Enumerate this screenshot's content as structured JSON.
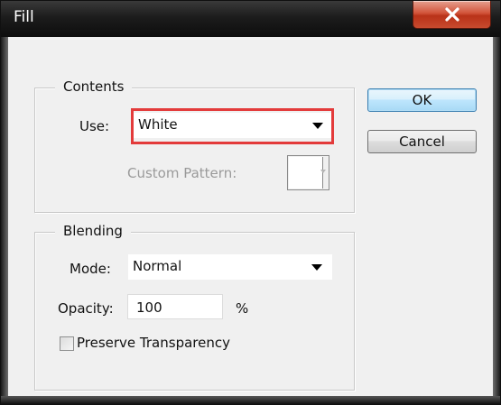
{
  "window": {
    "title": "Fill"
  },
  "contents": {
    "legend": "Contents",
    "use_label": "Use:",
    "use_value": "White",
    "custom_pattern_label": "Custom Pattern:"
  },
  "blending": {
    "legend": "Blending",
    "mode_label": "Mode:",
    "mode_value": "Normal",
    "opacity_label": "Opacity:",
    "opacity_value": "100",
    "opacity_unit": "%",
    "preserve_label": "Preserve Transparency",
    "preserve_checked": false
  },
  "buttons": {
    "ok": "OK",
    "cancel": "Cancel"
  },
  "colors": {
    "highlight": "#e33b3b",
    "close_button": "#c84a2e"
  }
}
